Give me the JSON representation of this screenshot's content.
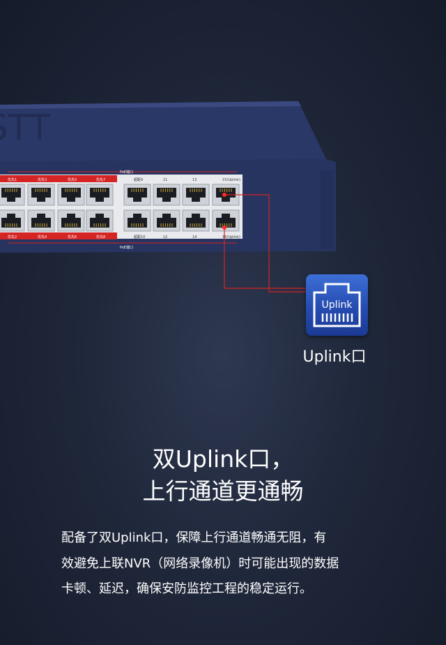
{
  "device": {
    "brand_partial": "STT",
    "poe_top_label": "PoE端口",
    "poe_bottom_label": "PoE端口",
    "port_labels_top": [
      "优先1",
      "优先3",
      "优先5",
      "优先7",
      "超距9",
      "11",
      "13",
      "15(Uplink)"
    ],
    "port_labels_bottom": [
      "优先2",
      "优先4",
      "优先6",
      "优先8",
      "超距10",
      "12",
      "14",
      "16(Uplink)"
    ]
  },
  "callout": {
    "icon_text": "Uplink",
    "label": "Uplink口"
  },
  "headline": {
    "line1": "双Uplink口，",
    "line2": "上行通道更通畅"
  },
  "body": {
    "line1": "配备了双Uplink口，保障上行通道畅通无阻，有",
    "line2": "效避免上联NVR（网络录像机）时可能出现的数据",
    "line3": "卡顿、延迟，确保安防监控工程的稳定运行。"
  },
  "colors": {
    "background": "#1f273a",
    "switch_body": "#2b3a6b",
    "accent_red": "#e02020",
    "icon_blue": "#2f5cc7",
    "text": "#ffffff"
  }
}
